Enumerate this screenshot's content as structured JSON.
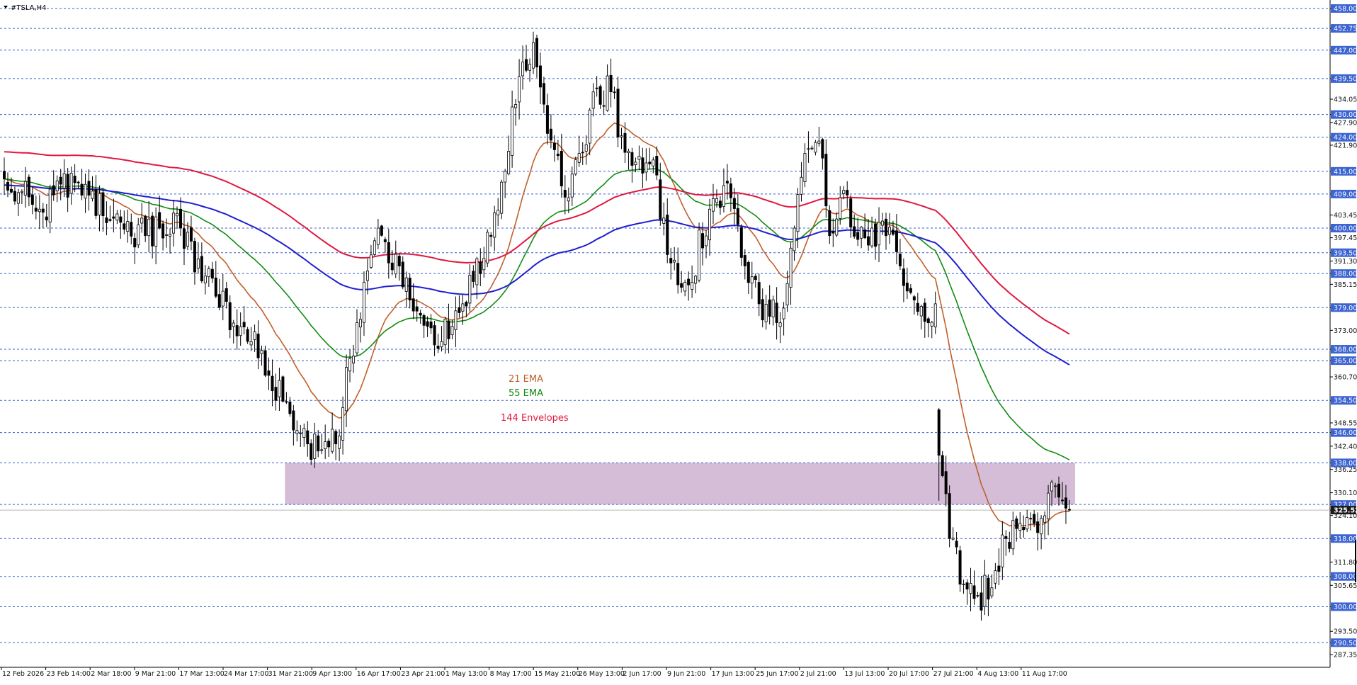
{
  "symbol_label": "#TSLA,H4",
  "colors": {
    "background": "#ffffff",
    "grid_line": "#3a5fcd",
    "hline_badge": "#3c64d2",
    "current_price_badge": "#1a1a1a",
    "zone_fill": "#d5bdd8",
    "candle_bull": "#000000",
    "candle_bear": "#000000",
    "ema21": "#c0602a",
    "ema55": "#128c12",
    "env144_upper": "#e0193f",
    "env144_lower": "#1f1fd0"
  },
  "legend": [
    {
      "label": "21 EMA",
      "color": "#c0602a"
    },
    {
      "label": "55 EMA",
      "color": "#128c12"
    },
    {
      "label": "144 Envelopes",
      "color": "#e0193f"
    }
  ],
  "chart_data": {
    "type": "candlestick",
    "symbol": "#TSLA,H4",
    "ylim": [
      284.0,
      459.5
    ],
    "x_tick_labels": [
      "12 Feb 2026",
      "23 Feb 14:00",
      "2 Mar 18:00",
      "9 Mar 21:00",
      "17 Mar 13:00",
      "24 Mar 17:00",
      "31 Mar 21:00",
      "9 Apr 13:00",
      "16 Apr 17:00",
      "23 Apr 21:00",
      "1 May 13:00",
      "8 May 17:00",
      "15 May 21:00",
      "26 May 13:00",
      "2 Jun 17:00",
      "9 Jun 21:00",
      "17 Jun 13:00",
      "25 Jun 17:00",
      "2 Jul 21:00",
      "13 Jul 13:00",
      "20 Jul 17:00",
      "27 Jul 21:00",
      "4 Aug 13:00",
      "11 Aug 17:00"
    ],
    "y_tick_labels": [
      "458.00",
      "452.75",
      "447.00",
      "439.50",
      "434.05",
      "430.00",
      "427.90",
      "424.00",
      "421.90",
      "415.00",
      "409.00",
      "403.45",
      "400.00",
      "397.45",
      "393.50",
      "391.30",
      "388.00",
      "385.15",
      "379.00",
      "373.00",
      "368.00",
      "365.00",
      "360.70",
      "354.50",
      "348.55",
      "346.00",
      "342.40",
      "338.00",
      "336.25",
      "330.10",
      "327.00",
      "325.52",
      "324.10",
      "318.00",
      "311.80",
      "308.00",
      "305.65",
      "300.00",
      "293.50",
      "290.50",
      "287.35"
    ],
    "horizontal_lines": [
      458.0,
      452.75,
      447.0,
      439.5,
      430.0,
      424.0,
      415.0,
      409.0,
      400.0,
      393.5,
      388.0,
      379.0,
      368.0,
      365.0,
      354.5,
      346.0,
      338.0,
      327.0,
      318.0,
      308.0,
      300.0,
      290.5
    ],
    "current_price": 325.52,
    "zone": {
      "from_price": 327.0,
      "to_price": 338.0,
      "start_label": "31 Mar 21:00"
    },
    "anchors": [
      {
        "i": 0,
        "price": 413
      },
      {
        "i": 10,
        "price": 405
      },
      {
        "i": 20,
        "price": 412
      },
      {
        "i": 30,
        "price": 402
      },
      {
        "i": 40,
        "price": 398
      },
      {
        "i": 50,
        "price": 400
      },
      {
        "i": 60,
        "price": 382
      },
      {
        "i": 70,
        "price": 370
      },
      {
        "i": 80,
        "price": 354
      },
      {
        "i": 86,
        "price": 343
      },
      {
        "i": 94,
        "price": 343
      },
      {
        "i": 100,
        "price": 375
      },
      {
        "i": 106,
        "price": 400
      },
      {
        "i": 112,
        "price": 390
      },
      {
        "i": 118,
        "price": 377
      },
      {
        "i": 124,
        "price": 370
      },
      {
        "i": 130,
        "price": 380
      },
      {
        "i": 136,
        "price": 392
      },
      {
        "i": 142,
        "price": 415
      },
      {
        "i": 146,
        "price": 440
      },
      {
        "i": 150,
        "price": 449
      },
      {
        "i": 154,
        "price": 425
      },
      {
        "i": 160,
        "price": 408
      },
      {
        "i": 164,
        "price": 420
      },
      {
        "i": 168,
        "price": 437
      },
      {
        "i": 172,
        "price": 436
      },
      {
        "i": 176,
        "price": 420
      },
      {
        "i": 180,
        "price": 419
      },
      {
        "i": 184,
        "price": 418
      },
      {
        "i": 188,
        "price": 393
      },
      {
        "i": 194,
        "price": 385
      },
      {
        "i": 200,
        "price": 405
      },
      {
        "i": 206,
        "price": 408
      },
      {
        "i": 210,
        "price": 390
      },
      {
        "i": 214,
        "price": 380
      },
      {
        "i": 220,
        "price": 375
      },
      {
        "i": 224,
        "price": 400
      },
      {
        "i": 228,
        "price": 421
      },
      {
        "i": 231,
        "price": 423
      },
      {
        "i": 234,
        "price": 398
      },
      {
        "i": 238,
        "price": 410
      },
      {
        "i": 242,
        "price": 397
      },
      {
        "i": 246,
        "price": 400
      },
      {
        "i": 250,
        "price": 398
      },
      {
        "i": 254,
        "price": 390
      },
      {
        "i": 258,
        "price": 381
      },
      {
        "i": 262,
        "price": 375
      },
      {
        "i": 264,
        "price": 380
      },
      {
        "i": 265,
        "price": 340
      },
      {
        "i": 268,
        "price": 318
      },
      {
        "i": 272,
        "price": 306
      },
      {
        "i": 276,
        "price": 303
      },
      {
        "i": 280,
        "price": 305
      },
      {
        "i": 284,
        "price": 318
      },
      {
        "i": 288,
        "price": 322
      },
      {
        "i": 292,
        "price": 322
      },
      {
        "i": 296,
        "price": 330
      },
      {
        "i": 300,
        "price": 328
      },
      {
        "i": 302,
        "price": 325.5
      }
    ],
    "series": [
      {
        "name": "21 EMA",
        "period": 21,
        "color": "#c0602a"
      },
      {
        "name": "55 EMA",
        "period": 55,
        "color": "#128c12"
      },
      {
        "name": "144 Envelopes",
        "period": 144,
        "color": "#e0193f",
        "band": "upper"
      },
      {
        "name": "144 Envelopes",
        "period": 144,
        "color": "#1f1fd0",
        "band": "lower"
      }
    ]
  }
}
